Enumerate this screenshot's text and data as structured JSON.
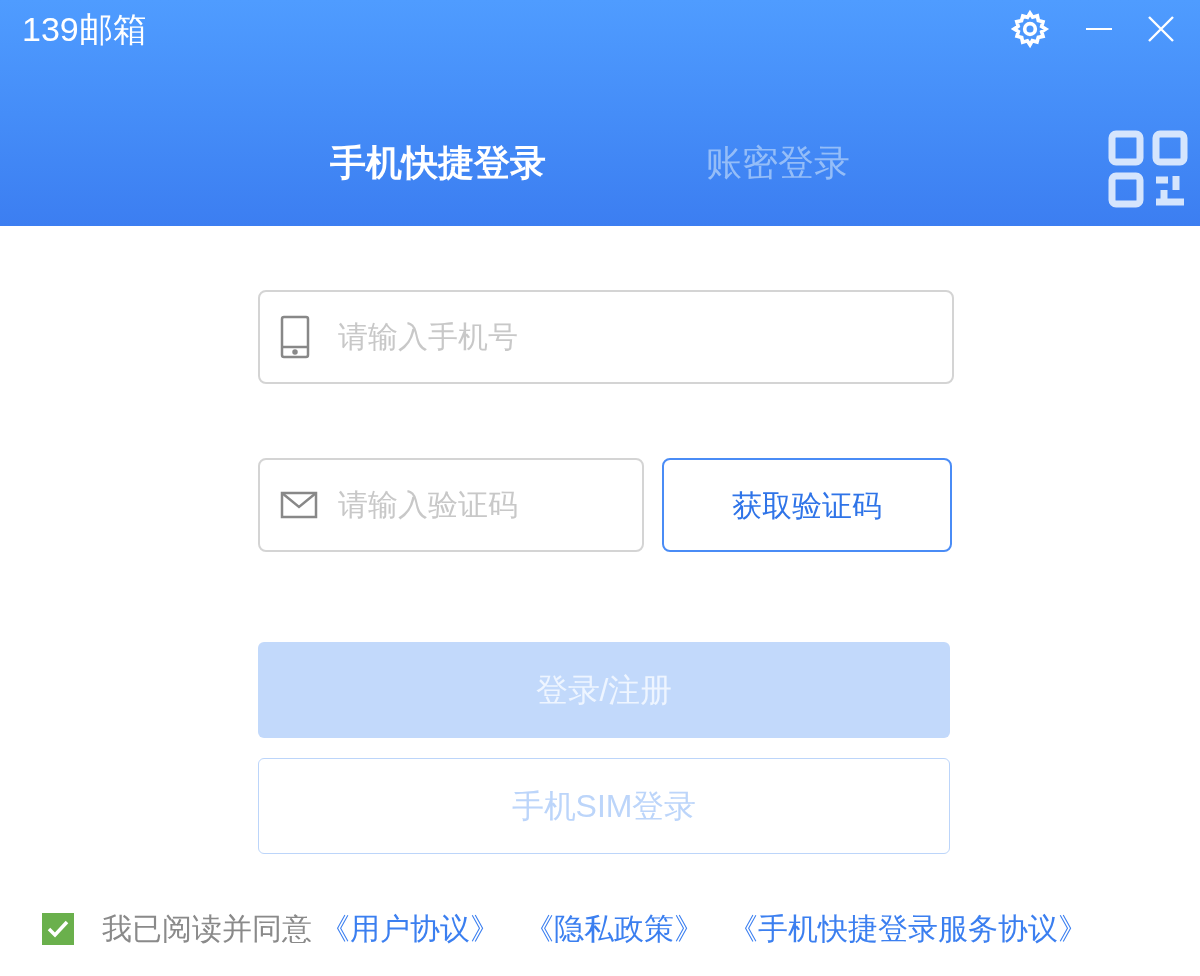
{
  "window": {
    "title": "139邮箱"
  },
  "tabs": [
    {
      "label": "手机快捷登录",
      "selected": true
    },
    {
      "label": "账密登录",
      "selected": false
    }
  ],
  "phone_field": {
    "placeholder": "请输入手机号"
  },
  "code_field": {
    "placeholder": "请输入验证码"
  },
  "get_code_button": {
    "label": "获取验证码"
  },
  "buttons": [
    {
      "label": "登录/注册",
      "kind": "primary",
      "disabled": true
    },
    {
      "label": "手机SIM登录",
      "kind": "outline",
      "disabled": true
    }
  ],
  "agreement": {
    "checked": true,
    "text": "我已阅读并同意",
    "links": [
      "《用户协议》",
      "《隐私政策》",
      "《手机快捷登录服务协议》"
    ]
  }
}
